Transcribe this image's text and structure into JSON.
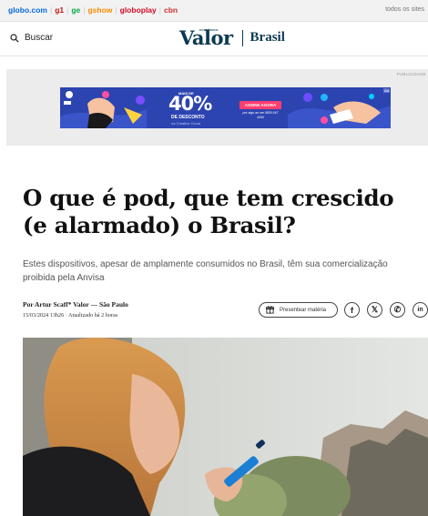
{
  "topbar": {
    "links": [
      {
        "label": "globo.com",
        "color": "#0669de"
      },
      {
        "label": "g1",
        "color": "#c4170c"
      },
      {
        "label": "ge",
        "color": "#06aa48"
      },
      {
        "label": "gshow",
        "color": "#fa8c00"
      },
      {
        "label": "globoplay",
        "color": "#d30b24"
      },
      {
        "label": "cbn",
        "color": "#d32f2f"
      }
    ],
    "more_label": "todos os sites"
  },
  "header": {
    "search_label": "Buscar",
    "logo_text": "Valor",
    "logo_tagline": "ECONÔMICO",
    "section_label": "Brasil"
  },
  "ad": {
    "tag": "PUBLICIDADE",
    "corner": "Ad",
    "headline_small": "MAIS DE",
    "headline_big": "40%",
    "desc": "DE DESCONTO",
    "sub": "na Creative Cloud",
    "cta": "ASSINE AGORA",
    "price": "por algo ao me 0800 047 4493"
  },
  "article": {
    "title": "O que é pod, que tem crescido (e alarmado) o Brasil?",
    "subtitle": "Estes dispositivos, apesar de amplamente consumidos no Brasil, têm sua comercialização proibida pela Anvisa",
    "byline": "Por Artur Scaff* Valor — São Paulo",
    "date": "15/03/2024 13h26 · Atualizado há 2 horas",
    "gift_label": "Presentear matéria"
  },
  "share": {
    "fb": "f",
    "x": "𝕏",
    "wa": "✆",
    "in": "in"
  },
  "colors": {
    "brand": "#0b3a52",
    "banner": "#2c44b0",
    "cta": "#ff3d6e"
  }
}
